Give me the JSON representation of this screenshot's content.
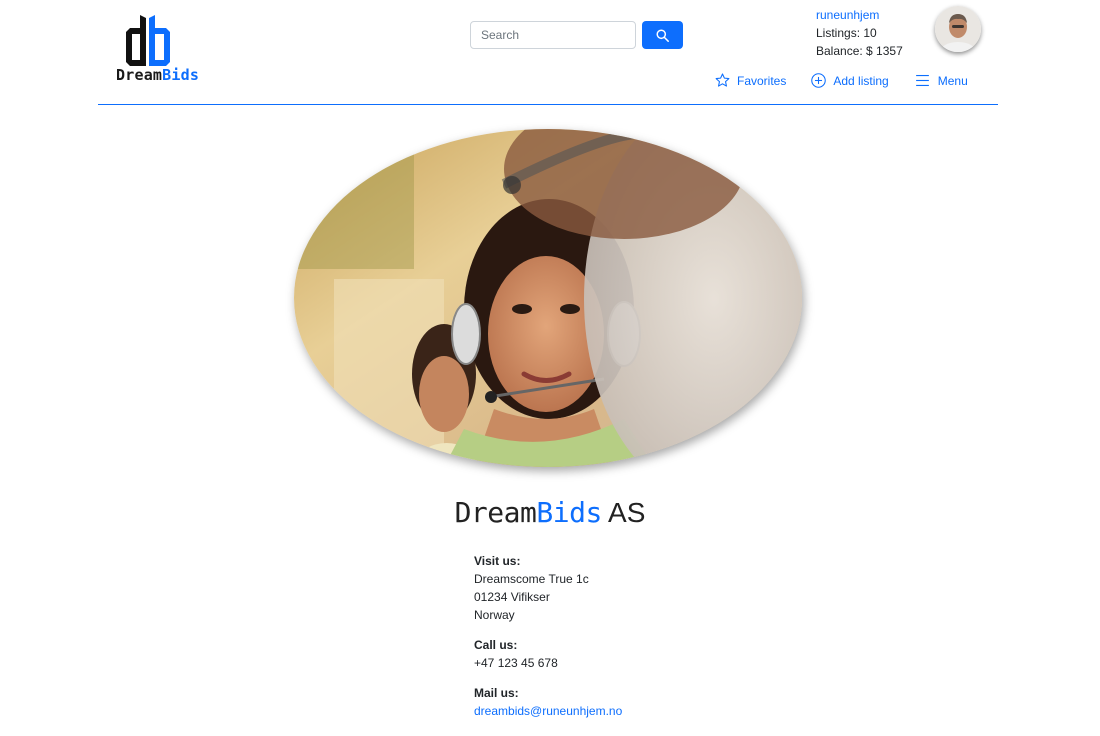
{
  "brand": {
    "logo_text_dream": "Dream",
    "logo_text_bids": "Bids",
    "accent_color": "#0d6efd"
  },
  "search": {
    "placeholder": "Search",
    "value": "",
    "button_icon": "search-icon"
  },
  "user": {
    "username": "runeunhjem",
    "listings_text": "Listings: 10",
    "balance_text": "Balance: $ 1357"
  },
  "nav": {
    "favorites": "Favorites",
    "add_listing": "Add listing",
    "menu": "Menu"
  },
  "company": {
    "name_dream": "Dream",
    "name_bids": "Bids",
    "name_suffix": " AS"
  },
  "contact": {
    "visit_heading": "Visit us:",
    "address_line1": "Dreamscome True 1c",
    "address_line2": "01234 Vifikser",
    "address_line3": "Norway",
    "call_heading": "Call us:",
    "phone": "+47 123 45 678",
    "mail_heading": "Mail us:",
    "email": "dreambids@runeunhjem.no"
  }
}
